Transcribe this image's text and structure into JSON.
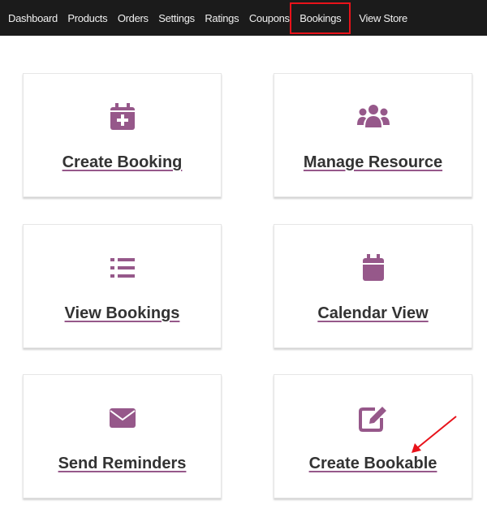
{
  "nav": {
    "items": [
      {
        "label": "Dashboard"
      },
      {
        "label": "Products"
      },
      {
        "label": "Orders"
      },
      {
        "label": "Settings"
      },
      {
        "label": "Ratings"
      },
      {
        "label": "Coupons"
      },
      {
        "label": "Bookings",
        "active": true
      },
      {
        "label": "View Store"
      }
    ]
  },
  "colors": {
    "accent": "#96588a",
    "nav_bg": "#1b1b1b",
    "highlight": "#e8121a"
  },
  "cards": [
    {
      "label": "Create Booking",
      "icon": "calendar-plus-icon"
    },
    {
      "label": "Manage Resource",
      "icon": "users-icon"
    },
    {
      "label": "View Bookings",
      "icon": "list-icon"
    },
    {
      "label": "Calendar View",
      "icon": "calendar-icon"
    },
    {
      "label": "Send Reminders",
      "icon": "envelope-icon"
    },
    {
      "label": "Create Bookable",
      "icon": "edit-icon"
    }
  ]
}
